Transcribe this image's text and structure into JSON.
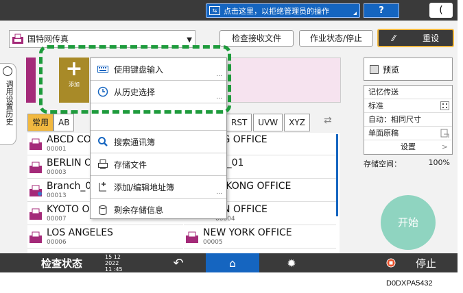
{
  "topbar": {
    "banner_text": "点击这里，以拒绝管理员的操作",
    "help_label": "?",
    "moon_label": "("
  },
  "destination": {
    "label": "国特网传真"
  },
  "buttons": {
    "check_received": "检查接收文件",
    "job_status": "作业状态/停止",
    "reset": "重设"
  },
  "history_tab": {
    "label": "调用设置历史"
  },
  "add_button": {
    "label": "添加"
  },
  "popup": {
    "items": [
      {
        "label": "使用键盘输入",
        "icon": "keyboard-icon"
      },
      {
        "label": "从历史选择",
        "icon": "clock-icon"
      },
      {
        "label": "搜索通讯簿",
        "icon": "search-icon"
      },
      {
        "label": "存储文件",
        "icon": "print-icon"
      },
      {
        "label": "添加/编辑地址簿",
        "icon": "add-edit-icon"
      },
      {
        "label": "剩余存储信息",
        "icon": "storage-icon"
      }
    ],
    "dots": "..."
  },
  "tabs": {
    "left": [
      "常用",
      "AB"
    ],
    "right": [
      "RST",
      "UVW",
      "XYZ"
    ]
  },
  "entries": [
    {
      "name": "ABCD CO",
      "num": "00001"
    },
    {
      "name": "NG OFFICE",
      "num": ""
    },
    {
      "name": "BERLIN O",
      "num": "00003"
    },
    {
      "name": "ch_01",
      "num": ""
    },
    {
      "name": "Branch_0",
      "num": "00013"
    },
    {
      "name": "G KONG OFFICE",
      "num": ""
    },
    {
      "name": "KYOTO O",
      "num": "00007"
    },
    {
      "name": "ON OFFICE",
      "num": "00004"
    },
    {
      "name": "LOS ANGELES",
      "num": "00006"
    },
    {
      "name": "NEW YORK OFFICE",
      "num": "00005"
    }
  ],
  "right_panel": {
    "preview": "预览",
    "memory_send": "记忆传送",
    "standard": "标准",
    "auto_size": "自动：相同尺寸",
    "one_side": "单面原稿",
    "settings": "设置",
    "storage_label": "存储空间：",
    "storage_value": "100%"
  },
  "start_label": "开始",
  "bottombar": {
    "check_status": "检查状态",
    "date": "15 12 2022",
    "time": "11 :45",
    "stop": "停止"
  },
  "caption": "D0DXPA5432",
  "colors": {
    "accent_blue": "#1565c0",
    "highlight_yellow": "#f1b840",
    "dashed_green": "#1e9b3c",
    "start_teal": "#8fd4c0"
  }
}
